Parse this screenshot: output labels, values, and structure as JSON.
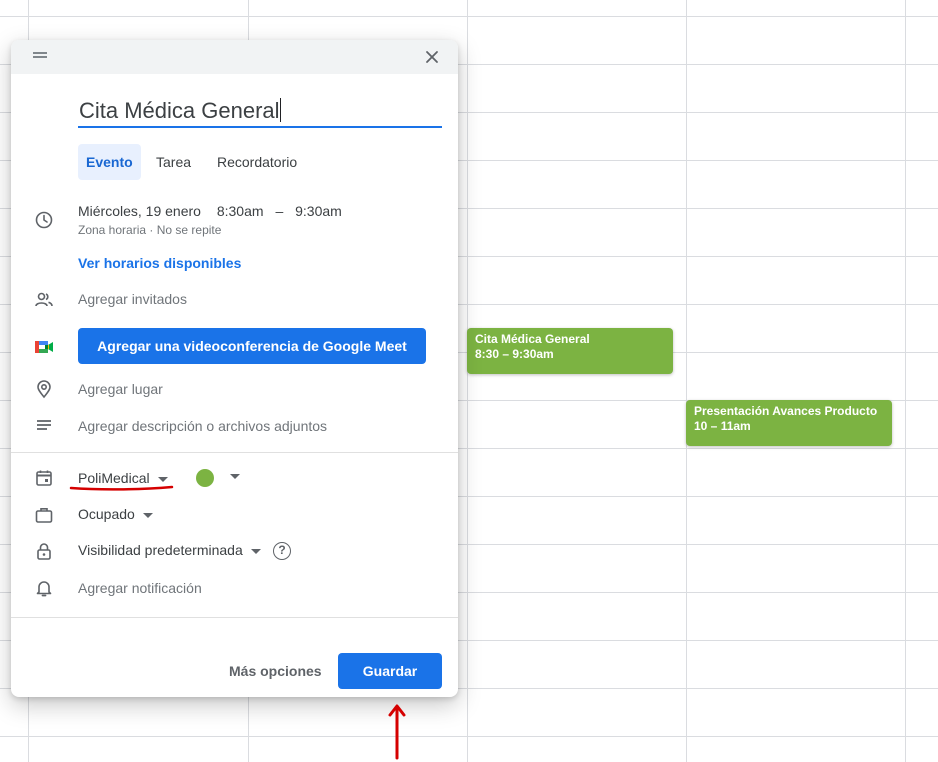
{
  "calendar_events": [
    {
      "title": "Cita Médica General",
      "time": "8:30 – 9:30am"
    },
    {
      "title": "Presentación Avances Producto",
      "time": "10 – 11am"
    }
  ],
  "colors": {
    "event_green": "#7cb342",
    "primary_blue": "#1a73e8",
    "annotation_red": "#d50000"
  },
  "dialog": {
    "title_value": "Cita Médica General",
    "tabs": [
      {
        "label": "Evento",
        "active": true
      },
      {
        "label": "Tarea",
        "active": false
      },
      {
        "label": "Recordatorio",
        "active": false
      }
    ],
    "datetime": {
      "date": "Miércoles, 19 enero",
      "start": "8:30am",
      "separator": "–",
      "end": "9:30am",
      "timezone_link": "Zona horaria",
      "dot": "·",
      "repeat": "No se repite"
    },
    "find_time_link": "Ver horarios disponibles",
    "add_guests": "Agregar invitados",
    "meet_button": "Agregar una videoconferencia de Google Meet",
    "add_location": "Agregar lugar",
    "add_description": "Agregar descripción o archivos adjuntos",
    "calendar_select": "PoliMedical",
    "busy_select": "Ocupado",
    "visibility_select": "Visibilidad predeterminada",
    "help": "?",
    "add_notification": "Agregar notificación",
    "more_options": "Más opciones",
    "save": "Guardar"
  },
  "icons": [
    "drag-handle-icon",
    "close-icon",
    "clock-icon",
    "people-icon",
    "google-meet-icon",
    "location-pin-icon",
    "description-icon",
    "calendar-icon",
    "briefcase-icon",
    "lock-icon",
    "help-icon",
    "bell-icon",
    "red-arrow-up-icon"
  ]
}
